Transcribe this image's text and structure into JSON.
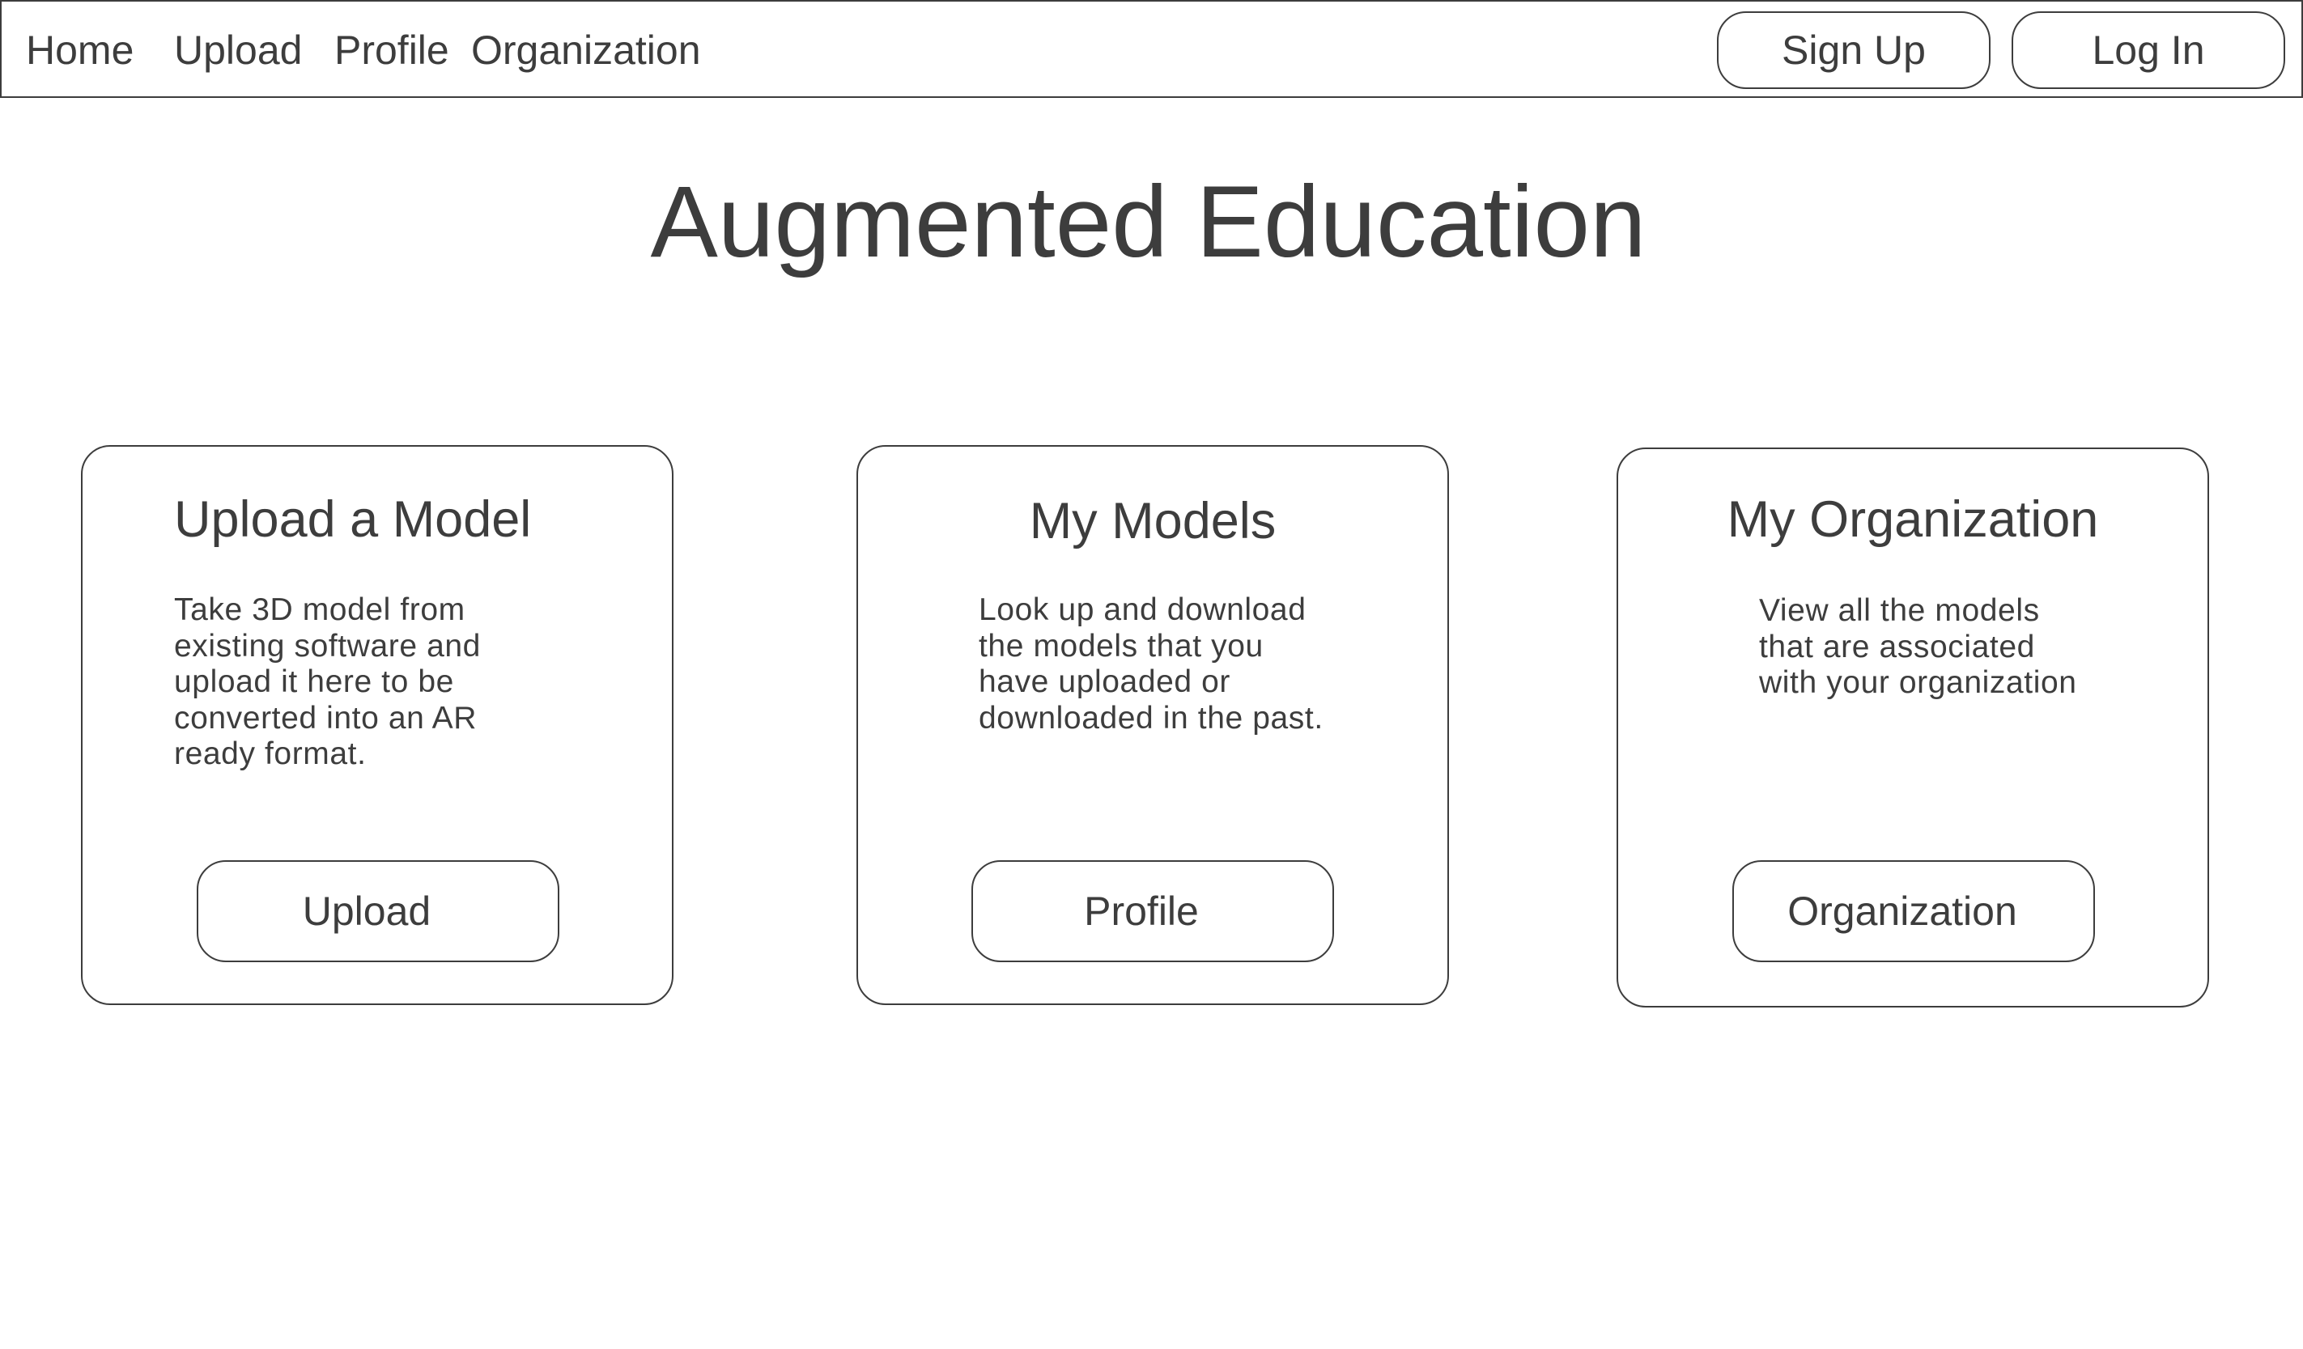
{
  "nav": {
    "links": [
      {
        "label": "Home"
      },
      {
        "label": "Upload"
      },
      {
        "label": "Profile"
      },
      {
        "label": "Organization"
      }
    ],
    "sign_up_label": "Sign Up",
    "log_in_label": "Log In"
  },
  "page": {
    "title": "Augmented Education"
  },
  "cards": [
    {
      "title": "Upload a Model",
      "description": "Take 3D model from existing software and upload it here to be converted into an AR ready format.",
      "button_label": "Upload"
    },
    {
      "title": "My Models",
      "description": "Look up and download the models that you have uploaded or downloaded in the past.",
      "button_label": "Profile"
    },
    {
      "title": "My Organization",
      "description": "View all the models that are associated with your organization",
      "button_label": "Organization"
    }
  ]
}
